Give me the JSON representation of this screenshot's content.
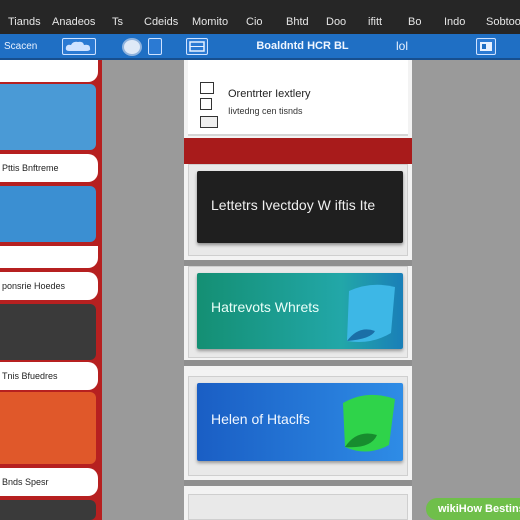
{
  "menubar": {
    "items": [
      "Tiands",
      "Anadeos",
      "Ts",
      "Cdeids",
      "Momito",
      "Cio",
      "Bhtd",
      "Doo",
      "ifitt",
      "Bo",
      "Indo",
      "Sobtoo"
    ]
  },
  "toolbar": {
    "left_label": "Scacen",
    "center_label": "Boaldntd HCR BL",
    "right_label": "lol"
  },
  "left_column": {
    "labels": [
      "Pttis Bnftreme",
      "ponsrie Hoedes",
      "Tnis Bfuedres",
      "Bnds Spesr"
    ]
  },
  "main": {
    "top_panel": {
      "title": "Orentrter Iextlery",
      "subtitle": "Iivtedng cen tisnds"
    },
    "cards": [
      {
        "title": "Lettetrs Ivectdoy W iftis Ite"
      },
      {
        "title": "Hatrevots Whrets"
      },
      {
        "title": "Helen of Htaclfs"
      }
    ]
  },
  "watermark": "wikiHow Bestins",
  "colors": {
    "menubar": "#262626",
    "toolbar": "#1f6fc4",
    "accent_red": "#b62020",
    "card_dark": "#1f1f1f",
    "card_teal": "#159b8a",
    "card_blue": "#1c76d4"
  }
}
